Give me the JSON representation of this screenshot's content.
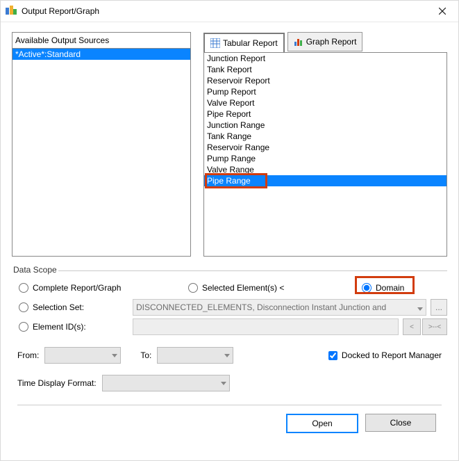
{
  "window": {
    "title": "Output Report/Graph"
  },
  "sources": {
    "header": "Available Output Sources",
    "items": [
      "*Active*:Standard"
    ],
    "selected_index": 0
  },
  "tabs": {
    "tabular": "Tabular Report",
    "graph": "Graph Report",
    "active": "tabular"
  },
  "reports": {
    "items": [
      "Junction Report",
      "Tank Report",
      "Reservoir Report",
      "Pump Report",
      "Valve Report",
      "Pipe Report",
      "Junction Range",
      "Tank Range",
      "Reservoir Range",
      "Pump Range",
      "Valve Range",
      "Pipe Range"
    ],
    "selected_index": 11
  },
  "scope": {
    "legend": "Data Scope",
    "complete": "Complete Report/Graph",
    "selected": "Selected Element(s) <",
    "domain": "Domain",
    "selection_set": "Selection Set:",
    "element_ids": "Element ID(s):",
    "selection_combo": "DISCONNECTED_ELEMENTS, Disconnection Instant Junction and",
    "ellipsis": "...",
    "prev": "<",
    "next": ">--<",
    "active": "domain"
  },
  "time": {
    "from": "From:",
    "to": "To:",
    "docked": "Docked to Report Manager",
    "format": "Time Display Format:"
  },
  "buttons": {
    "open": "Open",
    "close": "Close"
  }
}
